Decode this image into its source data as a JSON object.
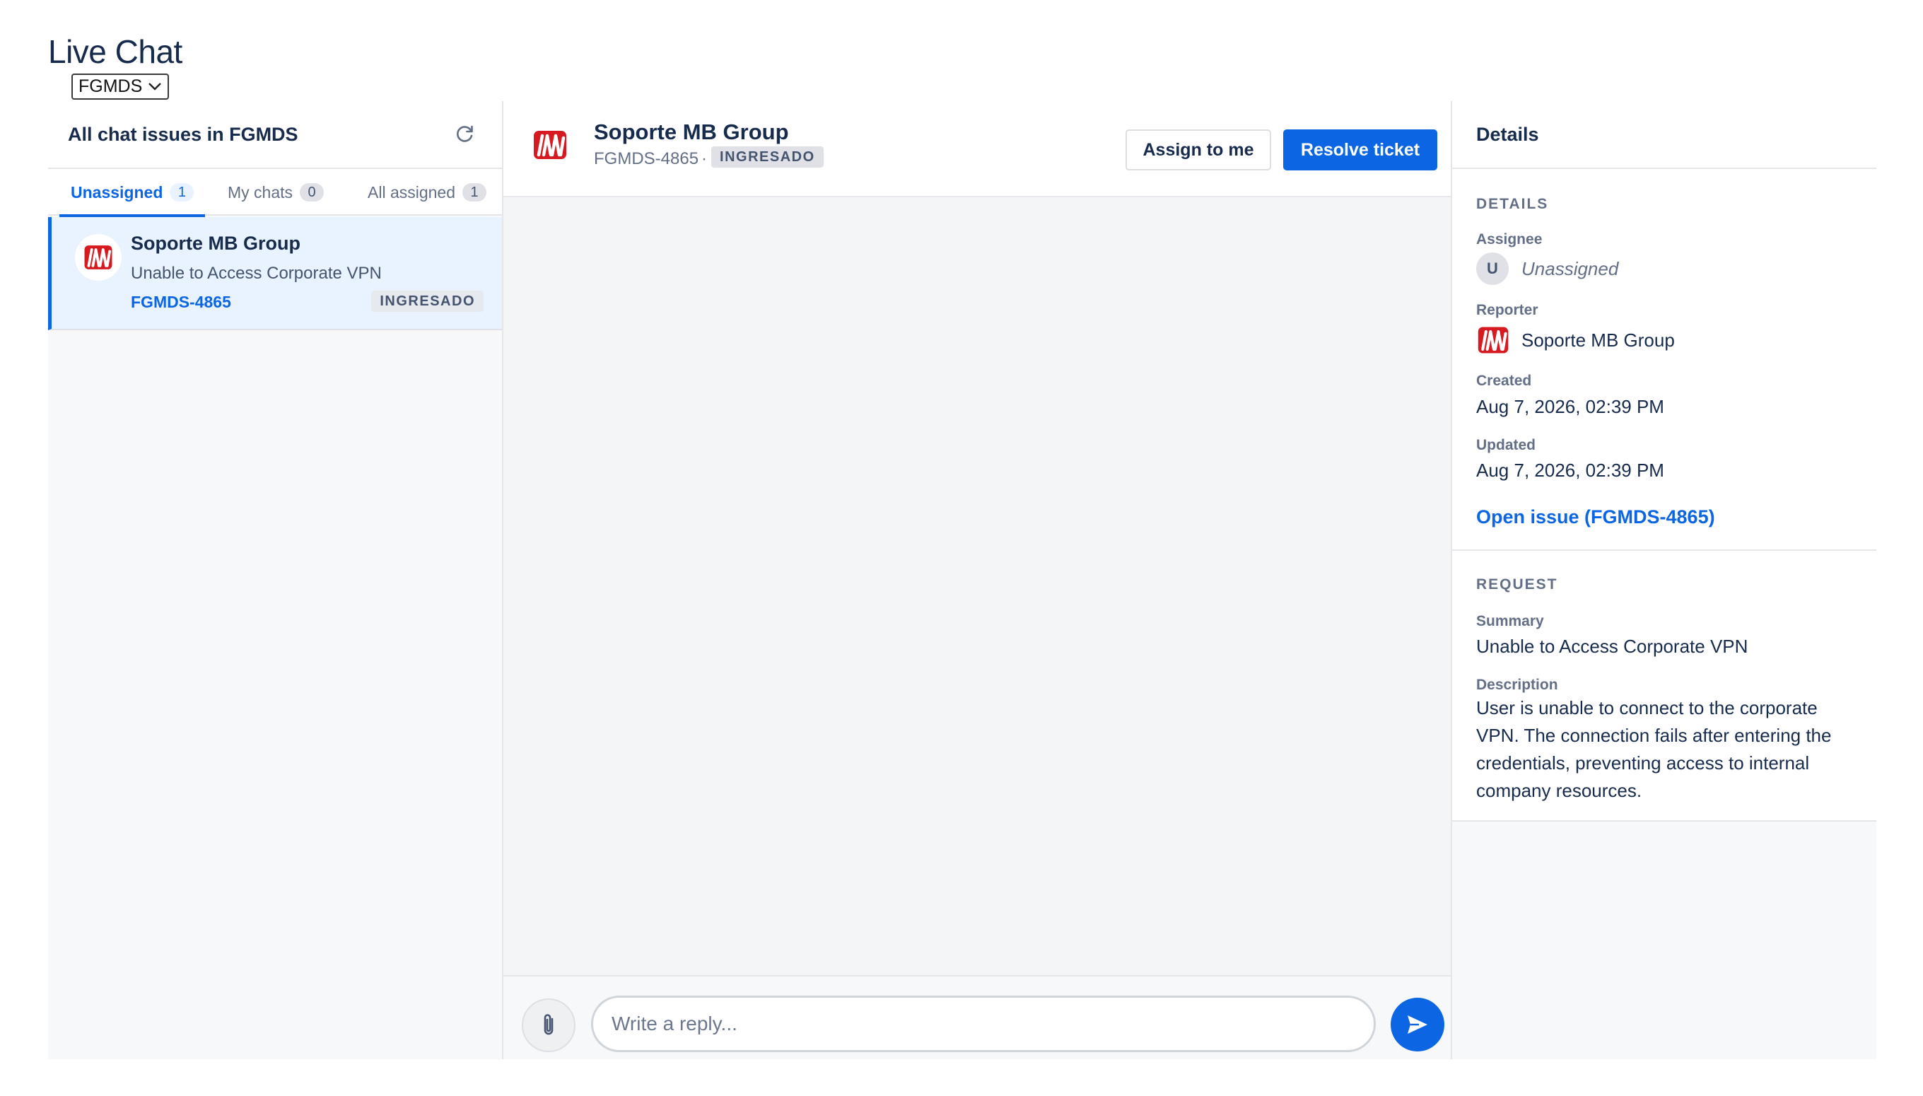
{
  "page": {
    "title": "Live Chat"
  },
  "project_selector": {
    "value": "FGMDS"
  },
  "queue": {
    "title": "All chat issues in FGMDS",
    "tabs": [
      {
        "label": "Unassigned",
        "count": "1",
        "active": true
      },
      {
        "label": "My chats",
        "count": "0",
        "active": false
      },
      {
        "label": "All assigned",
        "count": "1",
        "active": false
      }
    ],
    "items": [
      {
        "title": "Soporte MB Group",
        "summary": "Unable to Access Corporate VPN",
        "key": "FGMDS-4865",
        "status": "INGRESADO",
        "selected": true
      }
    ]
  },
  "conversation": {
    "title": "Soporte MB Group",
    "key": "FGMDS-4865",
    "separator": "·",
    "status": "INGRESADO",
    "assign_label": "Assign to me",
    "resolve_label": "Resolve ticket",
    "reply_placeholder": "Write a reply..."
  },
  "details": {
    "panel_title": "Details",
    "section_title": "DETAILS",
    "assignee_label": "Assignee",
    "assignee_initial": "U",
    "assignee_value": "Unassigned",
    "reporter_label": "Reporter",
    "reporter_value": "Soporte MB Group",
    "created_label": "Created",
    "created_value": "Aug 7, 2026, 02:39 PM",
    "updated_label": "Updated",
    "updated_value": "Aug 7, 2026, 02:39 PM",
    "open_issue_link": "Open issue (FGMDS-4865)"
  },
  "request": {
    "section_title": "REQUEST",
    "summary_label": "Summary",
    "summary_value": "Unable to Access Corporate VPN",
    "description_label": "Description",
    "description_value": "User is unable to connect to the corporate VPN. The connection fails after entering the credentials, preventing access to internal company resources."
  },
  "icons": {
    "project_dropdown": "chevron-down-icon",
    "refresh": "refresh-icon",
    "brand_logo": "mb-group-logo",
    "attach": "paperclip-icon",
    "send": "send-icon"
  },
  "colors": {
    "primary": "#0c66e4",
    "text": "#172b4d",
    "muted": "#626f86",
    "selected_bg": "#e9f2ff",
    "logo_red": "#d71920"
  }
}
